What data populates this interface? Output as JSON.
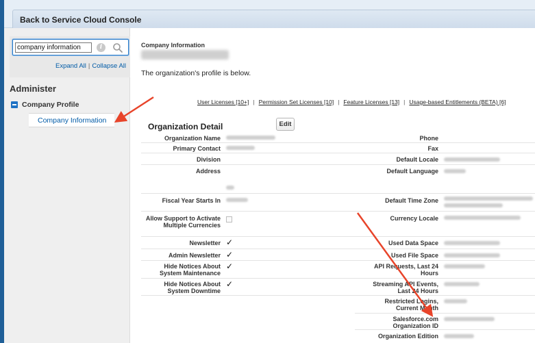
{
  "header": {
    "title": "Back to Service Cloud Console"
  },
  "sidebar": {
    "search": {
      "value": "company information",
      "info_icon": "info-icon",
      "search_icon": "magnifier-icon"
    },
    "expand_all": "Expand All",
    "separator": "|",
    "collapse_all": "Collapse All",
    "section_title": "Administer",
    "group_label": "Company Profile",
    "selected_item": "Company Information"
  },
  "main": {
    "breadcrumb": "Company Information",
    "description": "The organization's profile is below.",
    "license_links": [
      "User Licenses [10+]",
      "Permission Set Licenses [10]",
      "Feature Licenses [13]",
      "Usage-based Entitlements (BETA) [6]"
    ],
    "link_separator": "|",
    "detail_title": "Organization Detail",
    "edit_label": "Edit",
    "left_fields": {
      "org_name": "Organization Name",
      "primary_contact": "Primary Contact",
      "division": "Division",
      "address": "Address",
      "fiscal_year": "Fiscal Year Starts In",
      "allow_support": "Allow Support to Activate Multiple Currencies",
      "newsletter": "Newsletter",
      "admin_newsletter": "Admin Newsletter",
      "hide_maintenance": "Hide Notices About System Maintenance",
      "hide_downtime": "Hide Notices About System Downtime"
    },
    "right_fields": {
      "phone": "Phone",
      "fax": "Fax",
      "default_locale": "Default Locale",
      "default_language": "Default Language",
      "default_time_zone": "Default Time Zone",
      "currency_locale": "Currency Locale",
      "used_data_space": "Used Data Space",
      "used_file_space": "Used File Space",
      "api_requests": "API Requests, Last 24 Hours",
      "streaming_api": "Streaming API Events, Last 24 Hours",
      "restricted_logins": "Restricted Logins, Current Month",
      "org_id": "Salesforce.com Organization ID",
      "org_edition": "Organization Edition"
    },
    "check_mark": "✓"
  },
  "colors": {
    "accent": "#1f5f98",
    "link": "#015ba7",
    "arrow": "#e8442a"
  }
}
